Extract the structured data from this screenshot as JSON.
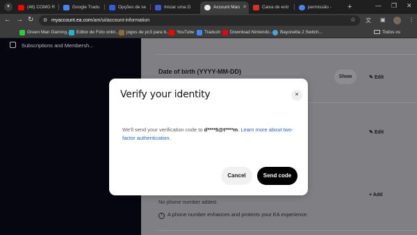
{
  "browser": {
    "tabs": [
      {
        "title": "(48) COMO R",
        "favicon_color": "#ff0000",
        "active": false
      },
      {
        "title": "Google Tradu",
        "favicon_color": "#4285f4",
        "active": false
      },
      {
        "title": "Opções de se",
        "favicon_color": "#3a5bd9",
        "active": false
      },
      {
        "title": "Iniciar uma D",
        "favicon_color": "#3a5bd9",
        "active": false
      },
      {
        "title": "Account Man",
        "favicon_color": "#ffffff",
        "active": true
      },
      {
        "title": "Caixa de entr",
        "favicon_color": "#d93025",
        "active": false
      },
      {
        "title": "permissão -",
        "favicon_color": "#4285f4",
        "active": false
      }
    ],
    "url": {
      "host": "myaccount.ea.com",
      "path": "/am/ui/account-information"
    },
    "bookmarks": [
      {
        "label": "Green Man Gaming...",
        "color": "#2ecc40"
      },
      {
        "label": "Editor de Foto onlin...",
        "color": "#27b4c8"
      },
      {
        "label": "jogos de pc3 para b...",
        "color": "#8a6d3b"
      },
      {
        "label": "YouTube",
        "color": "#ff0000"
      },
      {
        "label": "Traduzir",
        "color": "#4285f4"
      },
      {
        "label": "Download Nintendo...",
        "color": "#e60012"
      },
      {
        "label": "Bayonetta 2 Switch...",
        "color": "#4aa3df"
      }
    ],
    "all_bookmarks": "Todos os favoritos"
  },
  "sidebar": {
    "item_label": "Subscriptions and Membersh..."
  },
  "content": {
    "dob_label": "Date of birth (YYYY-MM-DD)",
    "show_label": "Show",
    "edit_label": "Edit",
    "add_label": "Add",
    "no_phone": "No phone number added.",
    "phone_info": "A phone number enhances and protects your EA experience."
  },
  "modal": {
    "title": "Verify your identity",
    "body_prefix": "We'll send your verification code to ",
    "masked_email": "d****5@t****m",
    "body_period": ". ",
    "link_text": "Learn more about two-factor authentication",
    "body_suffix": ".",
    "cancel_label": "Cancel",
    "send_label": "Send code"
  },
  "colors": {
    "sidebar_bg": "#05060f",
    "overlay_bg": "#808084",
    "link": "#1f5fd6",
    "primary_button": "#000000"
  }
}
